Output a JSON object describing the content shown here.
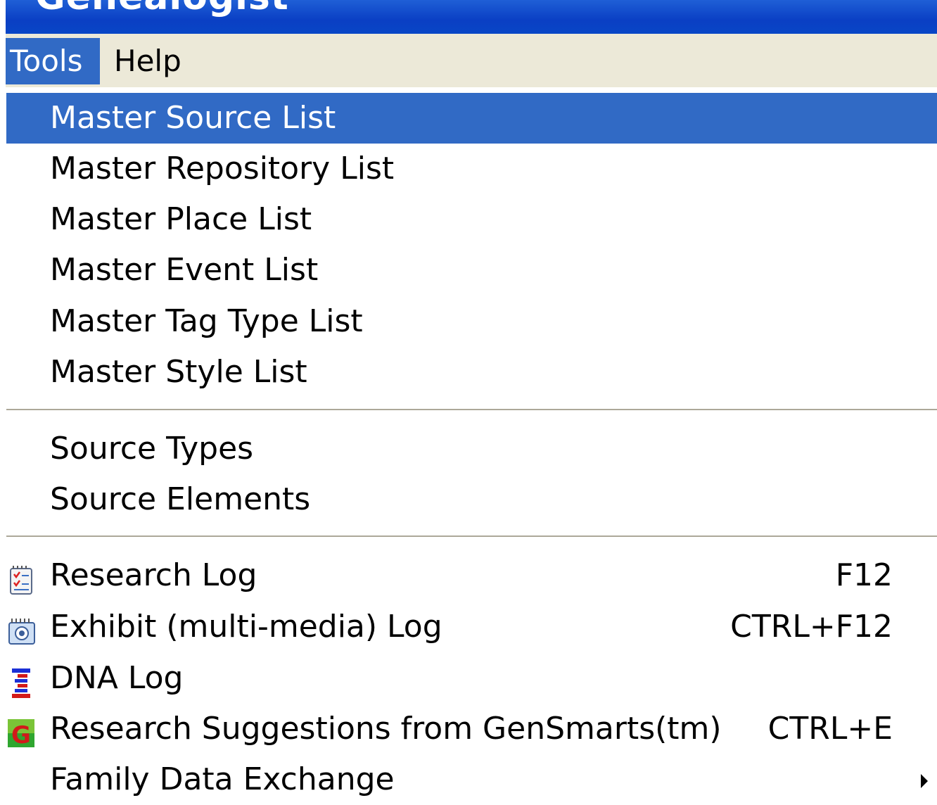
{
  "window": {
    "title": "Genealogist"
  },
  "menubar": {
    "items": [
      {
        "label": "Tools",
        "active": true
      },
      {
        "label": "Help",
        "active": false
      }
    ]
  },
  "dropdown": {
    "group1": [
      {
        "label": "Master Source List",
        "highlighted": true
      },
      {
        "label": "Master Repository List"
      },
      {
        "label": "Master Place List"
      },
      {
        "label": "Master Event List"
      },
      {
        "label": "Master Tag Type List"
      },
      {
        "label": "Master Style List"
      }
    ],
    "group2": [
      {
        "label": "Source Types"
      },
      {
        "label": "Source Elements"
      }
    ],
    "group3": [
      {
        "label": "Research Log",
        "shortcut": "F12",
        "icon": "research-log-icon"
      },
      {
        "label": "Exhibit (multi-media) Log",
        "shortcut": "CTRL+F12",
        "icon": "exhibit-log-icon"
      },
      {
        "label": "DNA Log",
        "shortcut": "",
        "icon": "dna-icon"
      },
      {
        "label": "Research Suggestions from GenSmarts(tm)",
        "shortcut": "CTRL+E",
        "icon": "gensmarts-icon"
      },
      {
        "label": "Family Data Exchange",
        "shortcut": "",
        "submenu": true
      }
    ]
  },
  "colors": {
    "highlight": "#316ac5",
    "menubar_bg": "#ece9d8",
    "titlebar": "#0a3fc4"
  }
}
